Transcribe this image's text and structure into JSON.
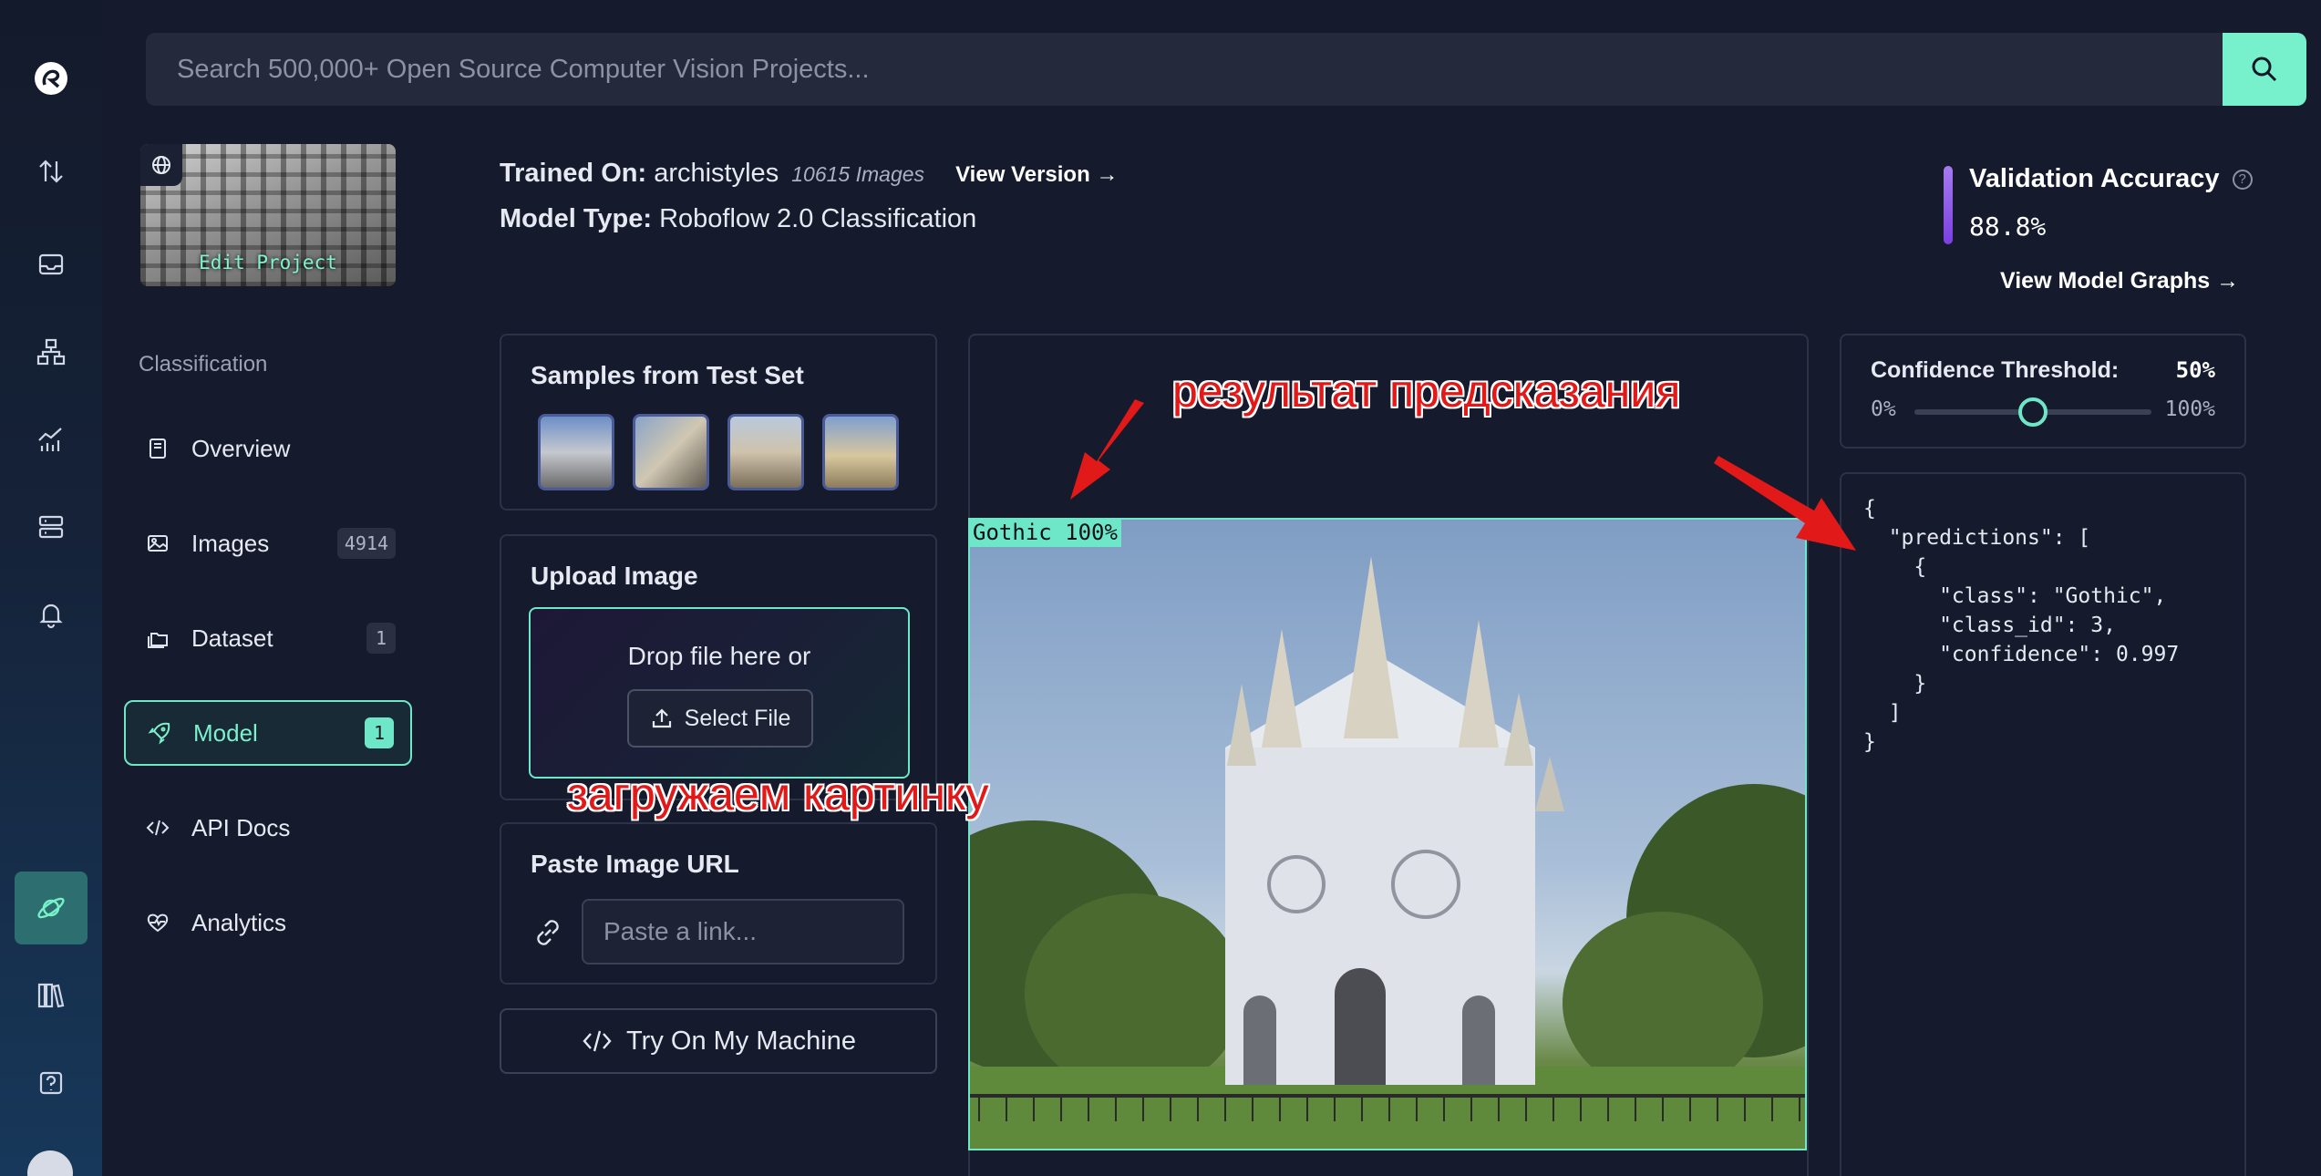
{
  "search": {
    "placeholder": "Search 500,000+ Open Source Computer Vision Projects..."
  },
  "rail": {
    "icons": [
      "roboflow-logo-icon",
      "sort-arrows-icon",
      "inbox-icon",
      "hierarchy-icon",
      "analytics-chart-icon",
      "server-icon",
      "bell-icon",
      "planet-icon",
      "library-icon",
      "help-icon",
      "avatar"
    ]
  },
  "project": {
    "thumbnail_label": "Edit Project",
    "section_label": "Classification"
  },
  "nav": {
    "items": [
      {
        "label": "Overview",
        "badge": ""
      },
      {
        "label": "Images",
        "badge": "4914"
      },
      {
        "label": "Dataset",
        "badge": "1"
      },
      {
        "label": "Model",
        "badge": "1",
        "active": true
      },
      {
        "label": "API Docs",
        "badge": ""
      },
      {
        "label": "Analytics",
        "badge": ""
      }
    ]
  },
  "header": {
    "trained_on_label": "Trained On:",
    "dataset_name": "archistyles",
    "image_count": "10615 Images",
    "view_version": "View Version →",
    "model_type_label": "Model Type:",
    "model_type": "Roboflow 2.0 Classification"
  },
  "validation": {
    "title": "Validation Accuracy",
    "help": "?",
    "value": "88.8%",
    "graphs_link": "View Model Graphs →"
  },
  "samples": {
    "title": "Samples from Test Set"
  },
  "upload": {
    "title": "Upload Image",
    "drop_text": "Drop file here or",
    "select_button": "Select File"
  },
  "paste": {
    "title": "Paste Image URL",
    "placeholder": "Paste a link..."
  },
  "try_button": "Try On My Machine",
  "result": {
    "prediction_label": "Gothic 100%"
  },
  "threshold": {
    "title": "Confidence Threshold:",
    "value": "50%",
    "min_label": "0%",
    "max_label": "100%",
    "level": 0.5
  },
  "output_json": "{\n  \"predictions\": [\n    {\n      \"class\": \"Gothic\",\n      \"class_id\": 3,\n      \"confidence\": 0.997\n    }\n  ]\n}",
  "annotations": {
    "prediction_result": "результат предсказания",
    "upload_image": "загружаем картинку"
  },
  "colors": {
    "accent": "#6ee7c8",
    "background": "#151a2c",
    "annotation_red": "#e11919",
    "validation_bar": "#8b4cf0"
  }
}
